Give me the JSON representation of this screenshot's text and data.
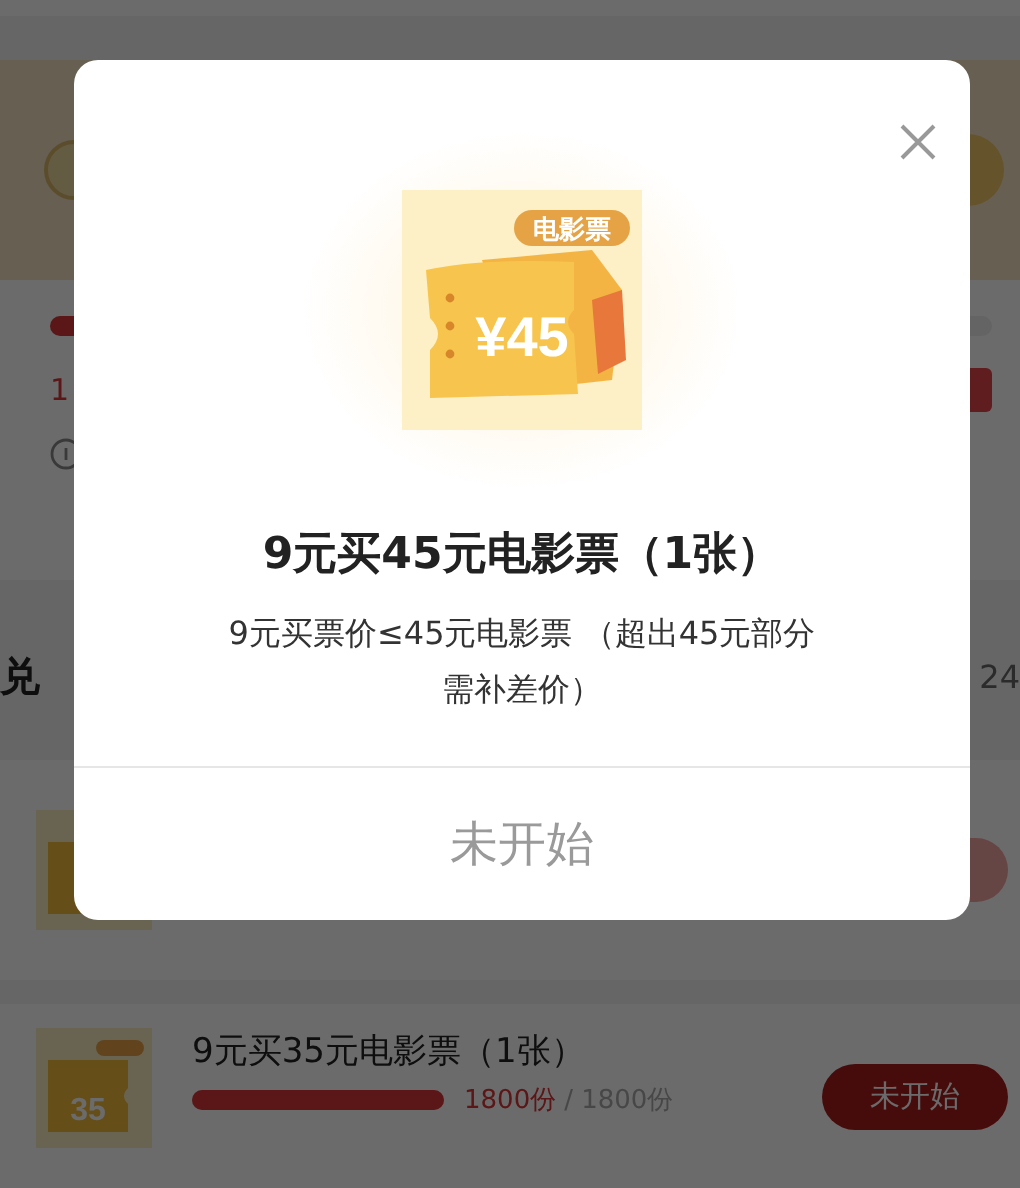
{
  "background": {
    "progress_count": "1",
    "section_title": "兑",
    "section_count": "24",
    "items": [
      {
        "title": "9元买35元电影票（1张）",
        "ticket_value": "35",
        "level": 1,
        "claimed": "1800份",
        "total": "/ 1800份",
        "button": "未开始"
      }
    ]
  },
  "dialog": {
    "badge": "电影票",
    "ticket_value": "¥45",
    "title": "9元买45元电影票（1张）",
    "description": "9元买票价≤45元电影票 （超出45元部分需补差价）",
    "button": "未开始",
    "button_disabled": true
  }
}
